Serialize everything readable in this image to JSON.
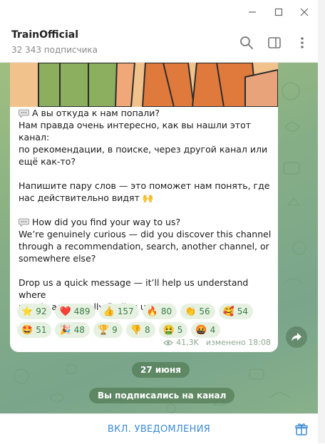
{
  "window": {
    "controls": [
      "minimize-icon",
      "maximize-icon",
      "close-icon"
    ]
  },
  "header": {
    "title": "TrainOfficial",
    "subtitle": "32 343 подписчика",
    "buttons": [
      "search-icon",
      "sidebar-toggle-icon",
      "more-vertical-icon"
    ]
  },
  "message": {
    "lines": [
      "А вы откуда к нам попали?",
      "Нам правда очень интересно, как вы нашли этот канал:",
      "по рекомендации, в поиске, через другой канал или",
      "ещё как-то?",
      "",
      "Напишите пару слов — это поможет нам понять, где",
      "нас действительно видят 🙌",
      "",
      "How did you find your way to us?",
      "We’re genuinely curious — did you discover this channel",
      "through a recommendation, search, another channel, or",
      "somewhere else?",
      "",
      "Drop us a quick message — it’ll help us understand where",
      "people are actually finding us 🙌"
    ],
    "reactions_row1": [
      {
        "emoji": "⭐",
        "count": "92"
      },
      {
        "emoji": "❤️",
        "count": "489"
      },
      {
        "emoji": "👍",
        "count": "157"
      },
      {
        "emoji": "🔥",
        "count": "80"
      },
      {
        "emoji": "👏",
        "count": "56"
      },
      {
        "emoji": "🥰",
        "count": "54"
      }
    ],
    "reactions_row2": [
      {
        "emoji": "🤩",
        "count": "51"
      },
      {
        "emoji": "🎉",
        "count": "48"
      },
      {
        "emoji": "🏆",
        "count": "9"
      },
      {
        "emoji": "👎",
        "count": "8"
      },
      {
        "emoji": "🤮",
        "count": "5"
      },
      {
        "emoji": "🤬",
        "count": "4"
      }
    ],
    "views": "41,3K",
    "edited_time": "изменено 18:08"
  },
  "service": {
    "date": "27 июня",
    "subscribed": "Вы подписались на канал"
  },
  "footer": {
    "notify_label": "ВКЛ. УВЕДОМЛЕНИЯ",
    "gift_icon": "gift-icon"
  },
  "colors": {
    "accent": "#3a8bd6",
    "reaction_bg": "#e6f1e2",
    "reaction_text": "#3a7d46",
    "chat_bg": "#86ae86"
  }
}
